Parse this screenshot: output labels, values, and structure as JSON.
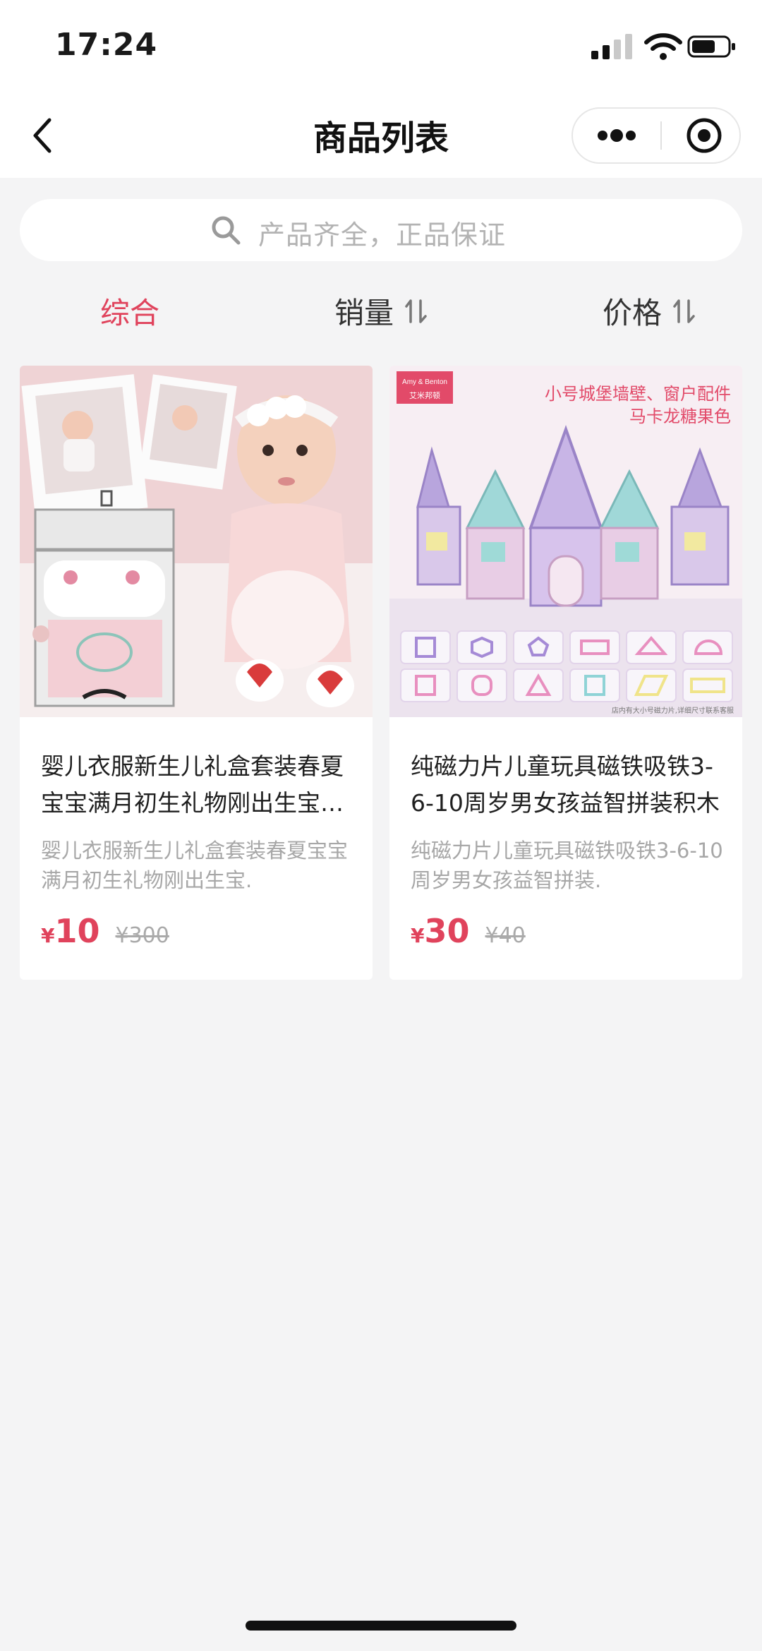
{
  "status_bar": {
    "time": "17:24",
    "icons": [
      "signal-icon",
      "wifi-icon",
      "battery-icon"
    ]
  },
  "nav": {
    "title": "商品列表",
    "back_icon": "chevron-left-icon",
    "more_icon": "more-dots-icon",
    "close_icon": "target-circle-icon"
  },
  "search": {
    "placeholder": "产品齐全，正品保证",
    "icon": "search-icon"
  },
  "sort_tabs": [
    {
      "label": "综合",
      "active": true
    },
    {
      "label": "销量",
      "active": false,
      "icon": "sort-arrows-icon"
    },
    {
      "label": "价格",
      "active": false,
      "icon": "sort-arrows-icon"
    }
  ],
  "products": [
    {
      "title": "婴儿衣服新生儿礼盒套装春夏宝宝满月初生礼物刚出生宝宝用品",
      "desc": "婴儿衣服新生儿礼盒套装春夏宝宝满月初生礼物刚出生宝.",
      "currency": "¥",
      "price": "10",
      "original_price": "¥300"
    },
    {
      "title": "纯磁力片儿童玩具磁铁吸铁3-6-10周岁男女孩益智拼装积木",
      "desc": "纯磁力片儿童玩具磁铁吸铁3-6-10周岁男女孩益智拼装.",
      "currency": "¥",
      "price": "30",
      "original_price": "¥40",
      "image_text": {
        "brand": "Amy & Benton",
        "brand_cn": "艾米邦顿",
        "headline_1": "小号城堡墙壁、窗户配件",
        "headline_2": "马卡龙糖果色",
        "footnote": "店内有大小号磁力片,详细尺寸联系客服"
      }
    }
  ],
  "colors": {
    "accent": "#e0435c",
    "background": "#f4f4f5",
    "card": "#ffffff"
  }
}
